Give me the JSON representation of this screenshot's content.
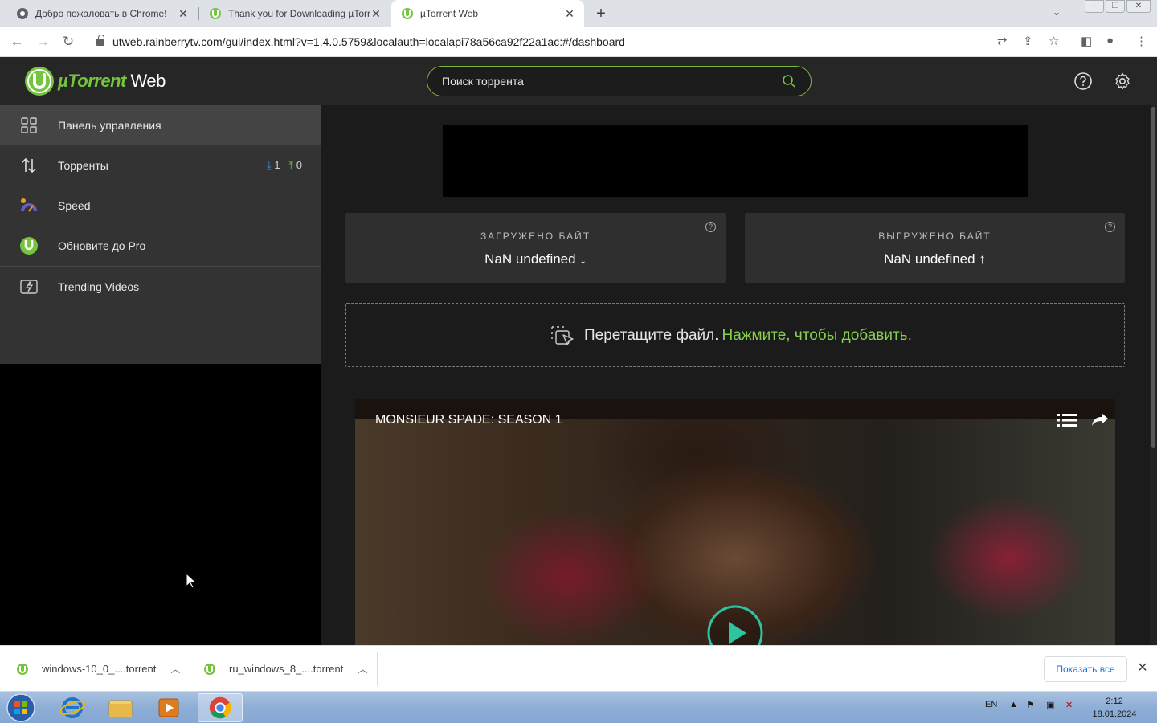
{
  "browser": {
    "tabs": [
      {
        "title": "Добро пожаловать в Chrome!",
        "active": false
      },
      {
        "title": "Thank you for Downloading µTorrent",
        "active": false
      },
      {
        "title": "µTorrent Web",
        "active": true
      }
    ],
    "url": "utweb.rainberrytv.com/gui/index.html?v=1.4.0.5759&localauth=localapi78a56ca92f22a1ac:#/dashboard"
  },
  "app": {
    "logo_mu": "µTorrent",
    "logo_web": " Web",
    "search_placeholder": "Поиск торрента"
  },
  "sidebar": {
    "items": [
      {
        "label": "Панель управления",
        "active": true
      },
      {
        "label": "Торренты",
        "down_count": "1",
        "up_count": "0"
      },
      {
        "label": "Speed"
      },
      {
        "label": "Обновите до Pro"
      },
      {
        "label": "Trending Videos"
      }
    ]
  },
  "stats": {
    "downloaded_label": "ЗАГРУЖЕНО БАЙТ",
    "downloaded_value": "NaN undefined",
    "uploaded_label": "ВЫГРУЖЕНО БАЙТ",
    "uploaded_value": "NaN undefined"
  },
  "dropzone": {
    "text": "Перетащите файл.",
    "link": "Нажмите, чтобы добавить."
  },
  "video": {
    "title": "MONSIEUR SPADE: SEASON 1"
  },
  "downloads": {
    "items": [
      {
        "name": "windows-10_0_....torrent"
      },
      {
        "name": "ru_windows_8_....torrent"
      }
    ],
    "show_all": "Показать все"
  },
  "taskbar": {
    "lang": "EN",
    "time": "2:12",
    "date": "18.01.2024"
  },
  "colors": {
    "accent_green": "#74c43e",
    "link_green": "#86cf50",
    "sidebar_bg": "#333333",
    "main_bg": "#1b1b1b"
  }
}
